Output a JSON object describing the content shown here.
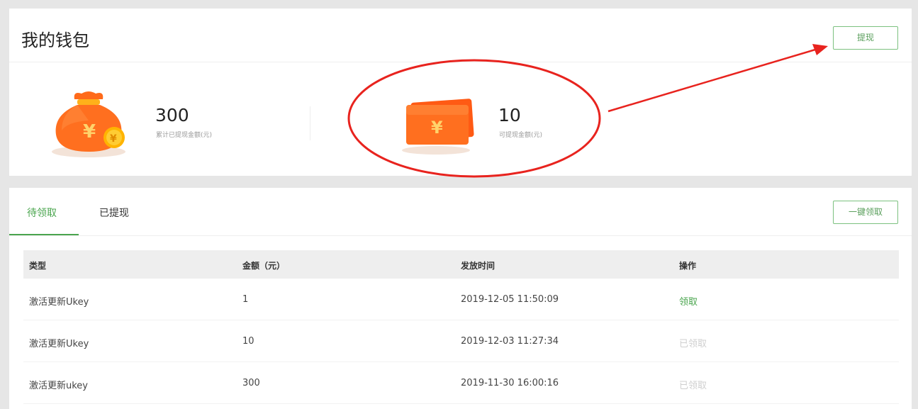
{
  "wallet": {
    "title": "我的钱包",
    "withdraw_label": "提现",
    "stats": [
      {
        "value": "300",
        "label": "累计已提现金额(元)",
        "icon": "money-bag-icon"
      },
      {
        "value": "10",
        "label": "可提现金额(元)",
        "icon": "red-envelope-icon"
      }
    ]
  },
  "tabs": [
    {
      "label": "待领取",
      "active": true
    },
    {
      "label": "已提现",
      "active": false
    }
  ],
  "claim_all_label": "一键领取",
  "table": {
    "headers": [
      "类型",
      "金额（元）",
      "发放时间",
      "操作"
    ],
    "rows": [
      {
        "type": "激活更新Ukey",
        "amount": "1",
        "time": "2019-12-05 11:50:09",
        "action": "领取"
      },
      {
        "type": "激活更新Ukey",
        "amount": "10",
        "time": "2019-12-03 11:27:34",
        "action": "已领取"
      },
      {
        "type": "激活更新ukey",
        "amount": "300",
        "time": "2019-11-30 16:00:16",
        "action": "已领取"
      }
    ]
  },
  "colors": {
    "accent_green": "#4aa54e",
    "annotation_red": "#e8231e",
    "icon_orange": "#ff6a1a"
  }
}
